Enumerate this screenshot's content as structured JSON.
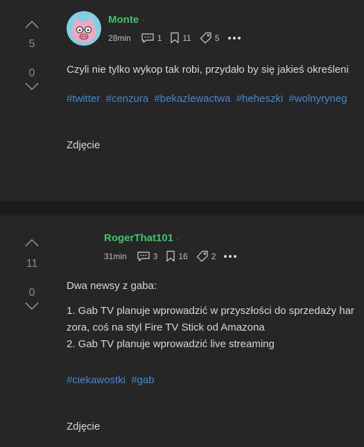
{
  "posts": [
    {
      "author": "Monte",
      "time": "28min",
      "comments": "1",
      "bookmarks": "11",
      "tags_count": "5",
      "upvotes": "5",
      "downvotes": "0",
      "text": "Czyli nie tylko wykop tak robi, przydało by się jakieś określeni",
      "tags": [
        "#twitter",
        "#cenzura",
        "#bekazlewactwa",
        "#heheszki",
        "#wolnyryneg"
      ],
      "photo_label": "Zdjęcie"
    },
    {
      "author": "RogerThat101",
      "time": "31min",
      "comments": "3",
      "bookmarks": "16",
      "tags_count": "2",
      "upvotes": "11",
      "downvotes": "0",
      "lines": [
        "Dwa newsy z gaba:",
        "1. Gab TV planuje wprowadzić w przyszłości do sprzedaży har",
        "zora, coś na styl Fire TV Stick od Amazona",
        "2. Gab TV planuje wprowadzić live streaming"
      ],
      "tags": [
        "#ciekawostki",
        "#gab"
      ],
      "photo_label": "Zdjęcie"
    }
  ],
  "colors": {
    "background": "#1b1b1b",
    "card": "#262626",
    "author": "#3bc46b",
    "link": "#3d8ad6"
  }
}
